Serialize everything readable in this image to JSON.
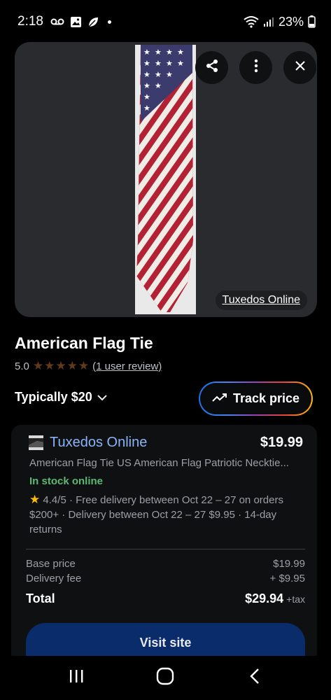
{
  "status_bar": {
    "time": "2:18",
    "battery": "23%",
    "icons": [
      "voicemail-icon",
      "gallery-icon",
      "leaf-icon",
      "dot-icon",
      "wifi-icon",
      "signal-icon",
      "battery-icon"
    ]
  },
  "image": {
    "source_label": "Tuxedos Online",
    "actions": [
      "share-icon",
      "more-vert-icon",
      "close-icon"
    ]
  },
  "product": {
    "title": "American Flag Tie",
    "rating": "5.0",
    "stars": 5,
    "reviews_label": "(1 user review)",
    "typical_price": "Typically $20",
    "track_price_label": "Track price"
  },
  "offer": {
    "merchant": "Tuxedos Online",
    "price": "$19.99",
    "description": "American Flag Tie US American Flag Patriotic Necktie...",
    "stock": "In stock online",
    "seller_rating": "4.4/5",
    "details": "· Free delivery between Oct 22 – 27 on orders $200+ · Delivery between Oct 22 – 27 $9.95 · 14-day returns",
    "base_price_label": "Base price",
    "base_price": "$19.99",
    "delivery_fee_label": "Delivery fee",
    "delivery_fee": "+ $9.95",
    "total_label": "Total",
    "total": "$29.94",
    "tax_label": "+tax",
    "visit_label": "Visit site"
  },
  "colors": {
    "background": "#000000",
    "card": "#2a2b2e",
    "link_blue": "#8ab4f8",
    "stock_green": "#5bb974",
    "star_gold": "#fbbc04",
    "visit_button": "#0b2c6b"
  }
}
